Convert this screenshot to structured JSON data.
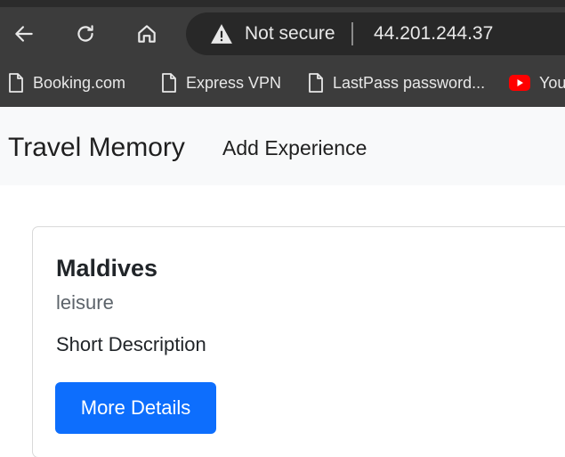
{
  "browser": {
    "address_status": "Not secure",
    "url": "44.201.244.37",
    "bookmarks": [
      {
        "label": "Booking.com",
        "icon": "page-icon"
      },
      {
        "label": "Express VPN",
        "icon": "page-icon"
      },
      {
        "label": "LastPass password...",
        "icon": "page-icon"
      },
      {
        "label": "You",
        "icon": "youtube-icon"
      }
    ],
    "colors": {
      "chrome": "#3c3c3c",
      "address_bar": "#282828"
    }
  },
  "navbar": {
    "brand": "Travel Memory",
    "links": [
      "Add Experience"
    ]
  },
  "card": {
    "title": "Maldives",
    "subtitle": "leisure",
    "text": "Short Description",
    "button_label": "More Details",
    "button_color": "#0d6efd"
  }
}
